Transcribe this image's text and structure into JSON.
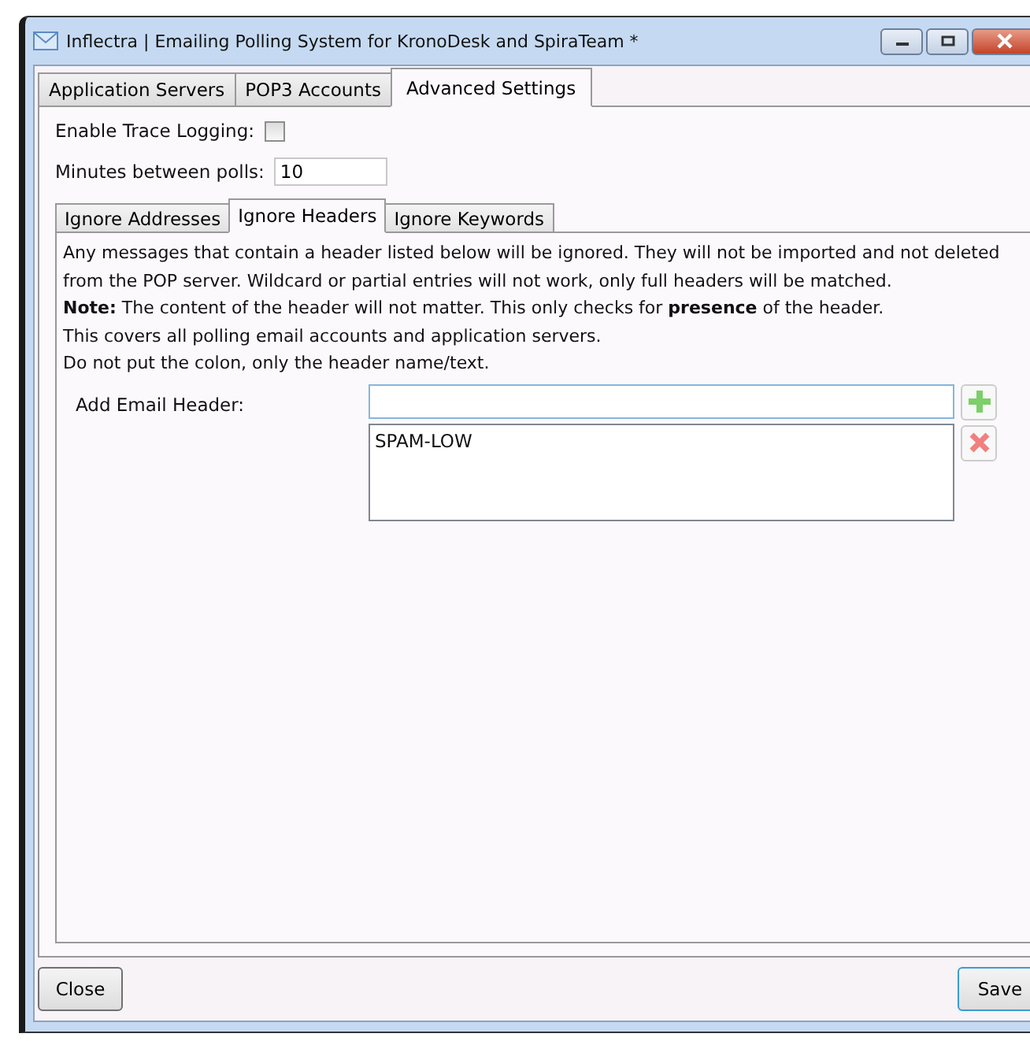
{
  "window": {
    "title": "Inflectra | Emailing Polling System for KronoDesk and SpiraTeam *"
  },
  "tabs": [
    {
      "label": "Application Servers",
      "selected": false
    },
    {
      "label": "POP3 Accounts",
      "selected": false
    },
    {
      "label": "Advanced Settings",
      "selected": true
    }
  ],
  "settings": {
    "trace_logging": {
      "label": "Enable Trace Logging:",
      "checked": false
    },
    "minutes": {
      "label": "Minutes between polls:",
      "value": "10"
    }
  },
  "sub_tabs": [
    {
      "label": "Ignore Addresses",
      "selected": false
    },
    {
      "label": "Ignore Headers",
      "selected": true
    },
    {
      "label": "Ignore Keywords",
      "selected": false
    }
  ],
  "description": [
    "Any messages that contain a header listed below will be ignored. They will not be imported and not deleted from the POP server. Wildcard or partial entries will not work, only full headers will be matched.",
    "**Note:** The content of the header will not matter. This only checks for **presence** of the header.",
    "This covers all polling email accounts and application servers.",
    "Do not put the colon, only the header name/text."
  ],
  "add_header": {
    "label": "Add Email Header:",
    "items": [
      "SPAM-LOW"
    ]
  },
  "buttons": {
    "close": "Close",
    "save": "Save"
  }
}
